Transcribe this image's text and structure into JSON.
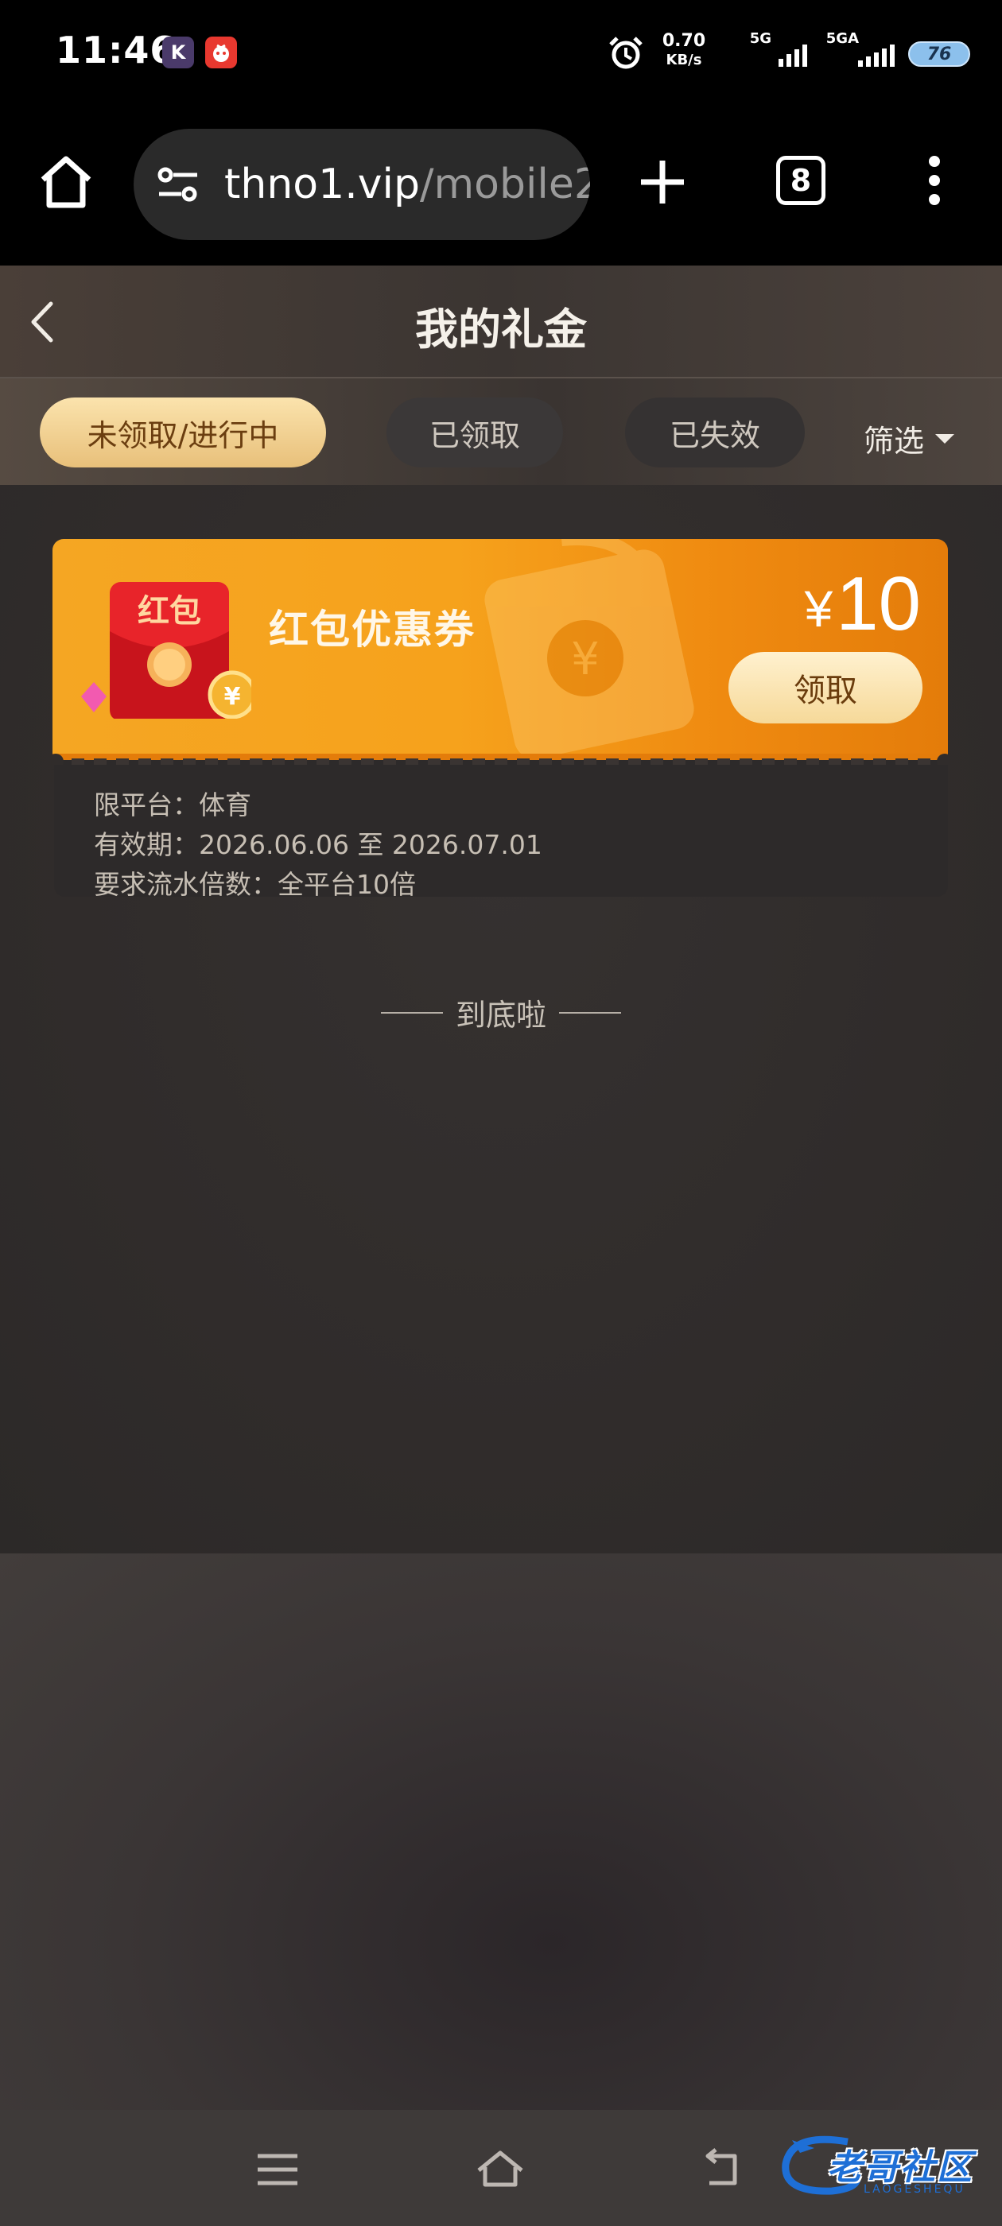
{
  "status_bar": {
    "time": "11:46",
    "app_badge_k": "K",
    "net_speed": "0.70",
    "net_speed_unit": "KB/s",
    "signal_1_label": "5G",
    "signal_2_label": "5GA",
    "battery": "76"
  },
  "browser": {
    "url_domain": "thno1.vip",
    "url_path": "/mobile2",
    "tab_count": "8"
  },
  "header": {
    "title": "我的礼金"
  },
  "tabs": [
    {
      "label": "未领取/进行中",
      "active": true
    },
    {
      "label": "已领取",
      "active": false
    },
    {
      "label": "已失效",
      "active": false
    }
  ],
  "filter_label": "筛选",
  "coupon": {
    "name": "红包优惠券",
    "art_label": "红包",
    "currency": "¥",
    "amount": "10",
    "claim_label": "领取",
    "platform_line": "限平台：体育",
    "validity_line": "有效期：2026.06.06 至 2026.07.01",
    "turnover_line": "要求流水倍数：全平台10倍"
  },
  "end_text": "到底啦",
  "watermark": {
    "text": "老哥社区",
    "sub": "LAOGESHEQU"
  },
  "colors": {
    "accent_gold": "#f6d999",
    "coupon_orange": "#f5a623",
    "page_bg": "#2f2b2a"
  }
}
